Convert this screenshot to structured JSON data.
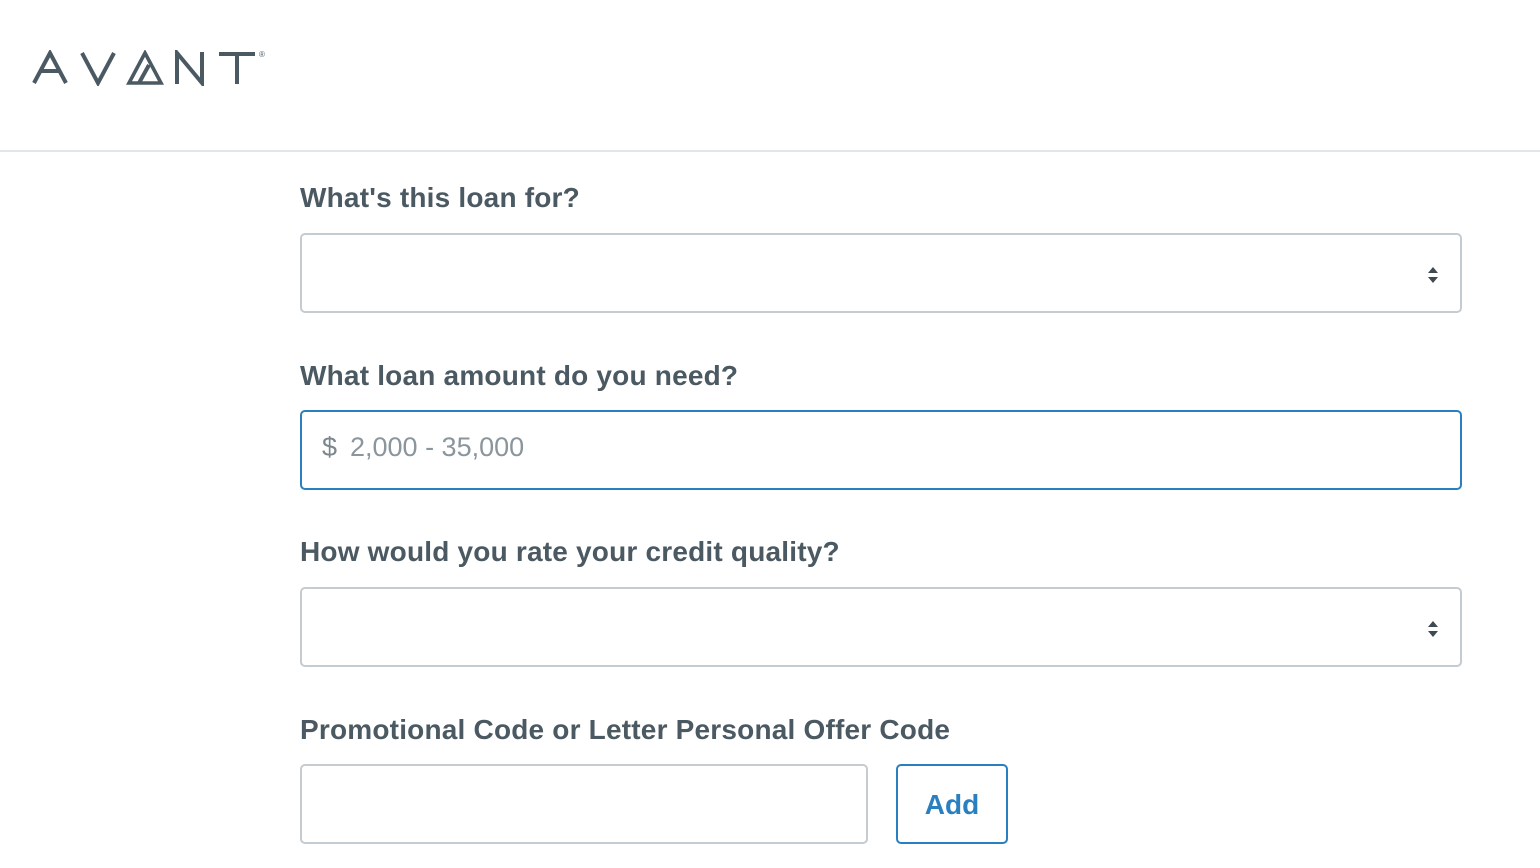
{
  "brand": {
    "name": "AVANT",
    "registered_mark": "®",
    "color": "#4b5962"
  },
  "form": {
    "loan_purpose": {
      "label": "What's this loan for?",
      "value": "",
      "icon": "stepper-arrows-icon"
    },
    "loan_amount": {
      "label": "What loan amount do you need?",
      "currency_symbol": "$",
      "placeholder": "2,000 - 35,000",
      "value": ""
    },
    "credit_quality": {
      "label": "How would you rate your credit quality?",
      "value": "",
      "icon": "stepper-arrows-icon"
    },
    "promo_code": {
      "label": "Promotional Code or Letter Personal Offer Code",
      "value": "",
      "add_label": "Add"
    }
  },
  "colors": {
    "text": "#4b5962",
    "border": "#c4ccd1",
    "accent": "#2a7fc0",
    "divider": "#e3e6e8"
  }
}
